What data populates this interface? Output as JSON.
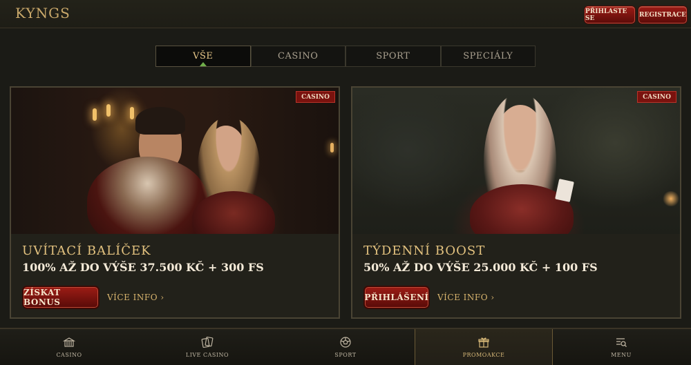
{
  "header": {
    "logo": "KYNGS",
    "login_label": "PŘIHLASTE SE",
    "register_label": "REGISTRACE"
  },
  "tabs": [
    {
      "label": "VŠE",
      "active": true
    },
    {
      "label": "CASINO",
      "active": false
    },
    {
      "label": "SPORT",
      "active": false
    },
    {
      "label": "SPECIÁLY",
      "active": false
    }
  ],
  "cards": [
    {
      "badge": "CASINO",
      "title": "UVÍTACÍ BALÍČEK",
      "subtitle": "100% AŽ DO VÝŠE 37.500 KČ + 300 FS",
      "cta_label": "ZÍSKAT BONUS",
      "more_label": "VÍCE INFO ›"
    },
    {
      "badge": "CASINO",
      "title": "TÝDENNÍ BOOST",
      "subtitle": "50% AŽ DO VÝŠE 25.000 KČ + 100 FS",
      "cta_label": "PŘIHLÁŠENÍ",
      "more_label": "VÍCE INFO ›"
    }
  ],
  "bottom_nav": [
    {
      "label": "CASINO",
      "icon": "casino-icon",
      "active": false
    },
    {
      "label": "LIVE CASINO",
      "icon": "cards-icon",
      "active": false
    },
    {
      "label": "SPORT",
      "icon": "soccer-ball-icon",
      "active": false
    },
    {
      "label": "PROMOAKCE",
      "icon": "gift-icon",
      "active": true
    },
    {
      "label": "MENU",
      "icon": "menu-search-icon",
      "active": false
    }
  ],
  "colors": {
    "accent_red": "#8a1610",
    "gold": "#e3c27f",
    "background": "#1b1b16"
  }
}
